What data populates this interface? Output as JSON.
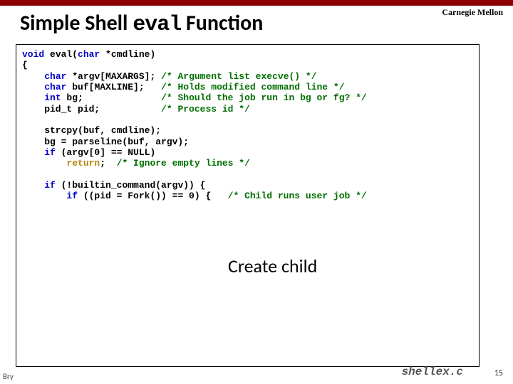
{
  "brand": "Carnegie Mellon",
  "title_before": "Simple Shell ",
  "title_code": "eval",
  "title_after": " Function",
  "code": {
    "l01a": "void",
    "l01b": " eval(",
    "l01c": "char",
    "l01d": " *cmdline)",
    "l02": "{",
    "l03a": "    ",
    "l03b": "char",
    "l03c": " *argv[MAXARGS]; ",
    "l03d": "/* Argument list execve() */",
    "l04a": "    ",
    "l04b": "char",
    "l04c": " buf[MAXLINE];   ",
    "l04d": "/* Holds modified command line */",
    "l05a": "    ",
    "l05b": "int",
    "l05c": " bg;              ",
    "l05d": "/* Should the job run in bg or fg? */",
    "l06a": "    pid_t pid;           ",
    "l06b": "/* Process id */",
    "blank1": " ",
    "l07": "    strcpy(buf, cmdline);",
    "l08": "    bg = parseline(buf, argv);",
    "l09a": "    ",
    "l09b": "if",
    "l09c": " (argv[0] == NULL)",
    "l10a": "        ",
    "l10b": "return",
    "l10c": ";  ",
    "l10d": "/* Ignore empty lines */",
    "blank2": " ",
    "l11a": "    ",
    "l11b": "if",
    "l11c": " (!builtin_command(argv)) {",
    "l12a": "        ",
    "l12b": "if",
    "l12c": " ((pid = Fork()) == 0) {   ",
    "l12d": "/* Child runs user job */"
  },
  "annotation": "Create child",
  "source_file": "shellex.c",
  "page_number": "15",
  "footer_left": "Bry"
}
